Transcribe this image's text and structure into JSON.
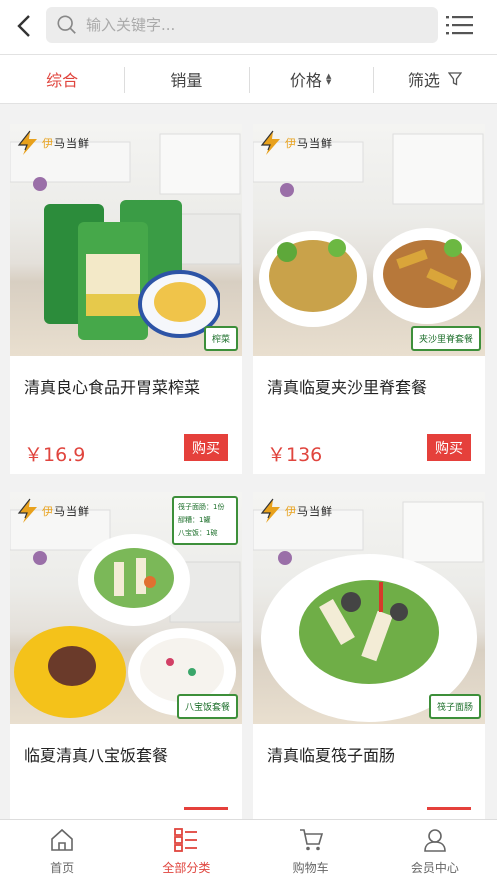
{
  "header": {
    "search_placeholder": "输入关键字..."
  },
  "filters": [
    {
      "label": "综合",
      "active": true
    },
    {
      "label": "销量"
    },
    {
      "label": "价格"
    },
    {
      "label": "筛选"
    }
  ],
  "brand": {
    "name_part1": "伊",
    "name_part2": "马当鲜"
  },
  "products": [
    {
      "title": "清真良心食品开胃菜榨菜",
      "price": "￥16.9",
      "buy_label": "购买",
      "tag": "榨菜"
    },
    {
      "title": "清真临夏夹沙里脊套餐",
      "price": "￥136",
      "buy_label": "购买",
      "tag": "夹沙里脊套餐"
    },
    {
      "title": "临夏清真八宝饭套餐",
      "price": "",
      "buy_label": "",
      "tag": "八宝饭套餐",
      "note": [
        "筏子面肠：1份",
        "醪糟：1罐",
        "八宝饭：1碗"
      ]
    },
    {
      "title": "清真临夏筏子面肠",
      "price": "",
      "buy_label": "",
      "tag": "筏子面肠"
    }
  ],
  "tabbar": [
    {
      "label": "首页",
      "icon": "home-icon"
    },
    {
      "label": "全部分类",
      "icon": "category-icon",
      "active": true
    },
    {
      "label": "购物车",
      "icon": "cart-icon"
    },
    {
      "label": "会员中心",
      "icon": "user-icon"
    }
  ],
  "colors": {
    "accent": "#e0453e",
    "tag_green": "#3d8f3a"
  }
}
